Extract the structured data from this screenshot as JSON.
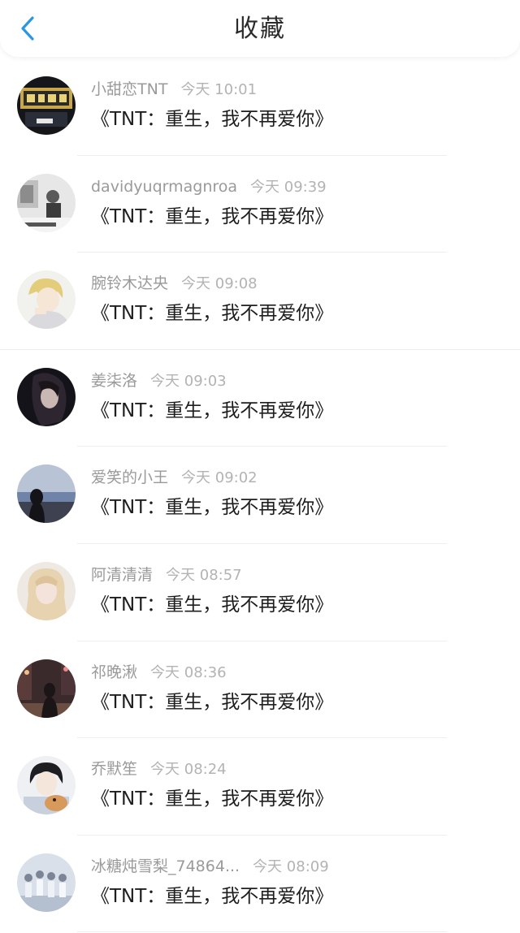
{
  "header": {
    "title": "收藏",
    "back_icon": "chevron-left-icon"
  },
  "colors": {
    "accent": "#2a97e0",
    "username": "#9a9a9a",
    "timestamp": "#b3b3b3",
    "divider": "#eeeeee"
  },
  "favorites": [
    {
      "username": "小甜恋TNT",
      "time": "今天 10:01",
      "title": "《TNT：重生，我不再爱你》",
      "avatar": "avatar-tnt-poster"
    },
    {
      "username": "davidyuqrmagnroa",
      "time": "今天 09:39",
      "title": "《TNT：重生，我不再爱你》",
      "avatar": "avatar-sketch"
    },
    {
      "username": "腕铃木达央",
      "time": "今天 09:08",
      "title": "《TNT：重生，我不再爱你》",
      "avatar": "avatar-anime-boy"
    },
    {
      "username": "姜柒洛",
      "time": "今天 09:03",
      "title": "《TNT：重生，我不再爱你》",
      "avatar": "avatar-dark-portrait"
    },
    {
      "username": "爱笑的小王",
      "time": "今天 09:02",
      "title": "《TNT：重生，我不再爱你》",
      "avatar": "avatar-sea"
    },
    {
      "username": "阿清清清",
      "time": "今天 08:57",
      "title": "《TNT：重生，我不再爱你》",
      "avatar": "avatar-blonde"
    },
    {
      "username": "祁晚湫",
      "time": "今天 08:36",
      "title": "《TNT：重生，我不再爱你》",
      "avatar": "avatar-night-street"
    },
    {
      "username": "乔默笙",
      "time": "今天 08:24",
      "title": "《TNT：重生，我不再爱你》",
      "avatar": "avatar-boy-dog"
    },
    {
      "username": "冰糖炖雪梨_74864...",
      "time": "今天 08:09",
      "title": "《TNT：重生，我不再爱你》",
      "avatar": "avatar-group"
    }
  ]
}
